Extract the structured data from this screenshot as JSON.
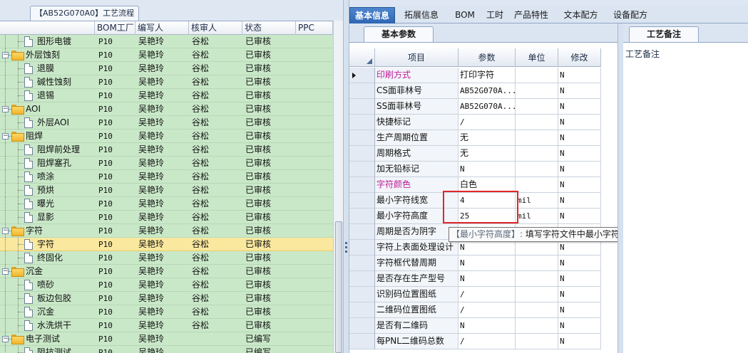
{
  "left_panel": {
    "tab_title": "【AB52G070A0】工艺流程",
    "columns": [
      "",
      "BOM工厂",
      "编写人",
      "核审人",
      "状态",
      "PPC"
    ],
    "rows": [
      {
        "level": 2,
        "type": "doc",
        "name": "图形电镀",
        "factory": "P10",
        "writer": "吴艳玲",
        "reviewer": "谷松",
        "status": "已审核",
        "selected": false
      },
      {
        "level": 1,
        "type": "folder",
        "name": "外层蚀刻",
        "factory": "P10",
        "writer": "吴艳玲",
        "reviewer": "谷松",
        "status": "已审核",
        "selected": false
      },
      {
        "level": 2,
        "type": "doc",
        "name": "退膜",
        "factory": "P10",
        "writer": "吴艳玲",
        "reviewer": "谷松",
        "status": "已审核",
        "selected": false
      },
      {
        "level": 2,
        "type": "doc",
        "name": "碱性蚀刻",
        "factory": "P10",
        "writer": "吴艳玲",
        "reviewer": "谷松",
        "status": "已审核",
        "selected": false
      },
      {
        "level": 2,
        "type": "doc",
        "name": "退锡",
        "factory": "P10",
        "writer": "吴艳玲",
        "reviewer": "谷松",
        "status": "已审核",
        "selected": false
      },
      {
        "level": 1,
        "type": "folder",
        "name": "AOI",
        "factory": "P10",
        "writer": "吴艳玲",
        "reviewer": "谷松",
        "status": "已审核",
        "selected": false
      },
      {
        "level": 2,
        "type": "doc",
        "name": "外层AOI",
        "factory": "P10",
        "writer": "吴艳玲",
        "reviewer": "谷松",
        "status": "已审核",
        "selected": false
      },
      {
        "level": 1,
        "type": "folder",
        "name": "阻焊",
        "factory": "P10",
        "writer": "吴艳玲",
        "reviewer": "谷松",
        "status": "已审核",
        "selected": false
      },
      {
        "level": 2,
        "type": "doc",
        "name": "阻焊前处理",
        "factory": "P10",
        "writer": "吴艳玲",
        "reviewer": "谷松",
        "status": "已审核",
        "selected": false
      },
      {
        "level": 2,
        "type": "doc",
        "name": "阻焊塞孔",
        "factory": "P10",
        "writer": "吴艳玲",
        "reviewer": "谷松",
        "status": "已审核",
        "selected": false
      },
      {
        "level": 2,
        "type": "doc",
        "name": "喷涂",
        "factory": "P10",
        "writer": "吴艳玲",
        "reviewer": "谷松",
        "status": "已审核",
        "selected": false
      },
      {
        "level": 2,
        "type": "doc",
        "name": "预烘",
        "factory": "P10",
        "writer": "吴艳玲",
        "reviewer": "谷松",
        "status": "已审核",
        "selected": false
      },
      {
        "level": 2,
        "type": "doc",
        "name": "曝光",
        "factory": "P10",
        "writer": "吴艳玲",
        "reviewer": "谷松",
        "status": "已审核",
        "selected": false
      },
      {
        "level": 2,
        "type": "doc",
        "name": "显影",
        "factory": "P10",
        "writer": "吴艳玲",
        "reviewer": "谷松",
        "status": "已审核",
        "selected": false
      },
      {
        "level": 1,
        "type": "folder",
        "name": "字符",
        "factory": "P10",
        "writer": "吴艳玲",
        "reviewer": "谷松",
        "status": "已审核",
        "selected": false
      },
      {
        "level": 2,
        "type": "doc",
        "name": "字符",
        "factory": "P10",
        "writer": "吴艳玲",
        "reviewer": "谷松",
        "status": "已审核",
        "selected": true
      },
      {
        "level": 2,
        "type": "doc",
        "name": "终固化",
        "factory": "P10",
        "writer": "吴艳玲",
        "reviewer": "谷松",
        "status": "已审核",
        "selected": false
      },
      {
        "level": 1,
        "type": "folder",
        "name": "沉金",
        "factory": "P10",
        "writer": "吴艳玲",
        "reviewer": "谷松",
        "status": "已审核",
        "selected": false
      },
      {
        "level": 2,
        "type": "doc",
        "name": "喷砂",
        "factory": "P10",
        "writer": "吴艳玲",
        "reviewer": "谷松",
        "status": "已审核",
        "selected": false
      },
      {
        "level": 2,
        "type": "doc",
        "name": "板边包胶",
        "factory": "P10",
        "writer": "吴艳玲",
        "reviewer": "谷松",
        "status": "已审核",
        "selected": false
      },
      {
        "level": 2,
        "type": "doc",
        "name": "沉金",
        "factory": "P10",
        "writer": "吴艳玲",
        "reviewer": "谷松",
        "status": "已审核",
        "selected": false
      },
      {
        "level": 2,
        "type": "doc",
        "name": "水洗烘干",
        "factory": "P10",
        "writer": "吴艳玲",
        "reviewer": "谷松",
        "status": "已审核",
        "selected": false
      },
      {
        "level": 1,
        "type": "folder",
        "name": "电子测试",
        "factory": "P10",
        "writer": "吴艳玲",
        "reviewer": "",
        "status": "已编写",
        "selected": false
      },
      {
        "level": 2,
        "type": "doc",
        "name": "阻抗测试",
        "factory": "P10",
        "writer": "吴艳玲",
        "reviewer": "",
        "status": "已编写",
        "selected": false
      }
    ]
  },
  "main_tabs": [
    "基本信息",
    "拓展信息",
    "BOM",
    "工时",
    "产品特性",
    "文本配方",
    "设备配方"
  ],
  "active_main_tab": "基本信息",
  "params": {
    "subtab": "基本参数",
    "columns": [
      "项目",
      "参数",
      "单位",
      "修改"
    ],
    "rows": [
      {
        "item": "印刷方式",
        "value": "打印字符",
        "unit": "",
        "modified": "N",
        "highlight": true,
        "current": true
      },
      {
        "item": "CS面菲林号",
        "value": "AB52G070A...",
        "unit": "",
        "modified": "N",
        "highlight": false,
        "current": false
      },
      {
        "item": "SS面菲林号",
        "value": "AB52G070A...",
        "unit": "",
        "modified": "N",
        "highlight": false,
        "current": false
      },
      {
        "item": "快捷标记",
        "value": "/",
        "unit": "",
        "modified": "N",
        "highlight": false,
        "current": false
      },
      {
        "item": "生产周期位置",
        "value": "无",
        "unit": "",
        "modified": "N",
        "highlight": false,
        "current": false
      },
      {
        "item": "周期格式",
        "value": "无",
        "unit": "",
        "modified": "N",
        "highlight": false,
        "current": false
      },
      {
        "item": "加无铅标记",
        "value": "N",
        "unit": "",
        "modified": "N",
        "highlight": false,
        "current": false
      },
      {
        "item": "字符颜色",
        "value": "白色",
        "unit": "",
        "modified": "N",
        "highlight": true,
        "current": false
      },
      {
        "item": "最小字符线宽",
        "value": "4",
        "unit": "mil",
        "modified": "N",
        "highlight": false,
        "current": false
      },
      {
        "item": "最小字符高度",
        "value": "25",
        "unit": "mil",
        "modified": "N",
        "highlight": false,
        "current": false
      },
      {
        "item": "周期是否为阴字",
        "value": "",
        "unit": "",
        "modified": "",
        "highlight": false,
        "current": false
      },
      {
        "item": "字符上表面处理设计",
        "value": "N",
        "unit": "",
        "modified": "N",
        "highlight": false,
        "current": false
      },
      {
        "item": "字符框代替周期",
        "value": "N",
        "unit": "",
        "modified": "N",
        "highlight": false,
        "current": false
      },
      {
        "item": "是否存在生产型号",
        "value": "N",
        "unit": "",
        "modified": "N",
        "highlight": false,
        "current": false
      },
      {
        "item": "识别码位置图纸",
        "value": "/",
        "unit": "",
        "modified": "N",
        "highlight": false,
        "current": false
      },
      {
        "item": "二维码位置图纸",
        "value": "/",
        "unit": "",
        "modified": "N",
        "highlight": false,
        "current": false
      },
      {
        "item": "是否有二维码",
        "value": "N",
        "unit": "",
        "modified": "N",
        "highlight": false,
        "current": false
      },
      {
        "item": "每PNL二维码总数",
        "value": "/",
        "unit": "",
        "modified": "N",
        "highlight": false,
        "current": false
      }
    ],
    "tooltip_key": "【最小字符高度】:",
    "tooltip_text": " 填写字符文件中最小字符高度值"
  },
  "remark": {
    "subtab": "工艺备注",
    "label": "工艺备注"
  },
  "colors": {
    "tree_bg": "#c9e8c8",
    "selected_row": "#fae89e",
    "active_tab": "#2e66b3",
    "highlight_text": "#c01a9a",
    "red_box": "#e0262a"
  }
}
